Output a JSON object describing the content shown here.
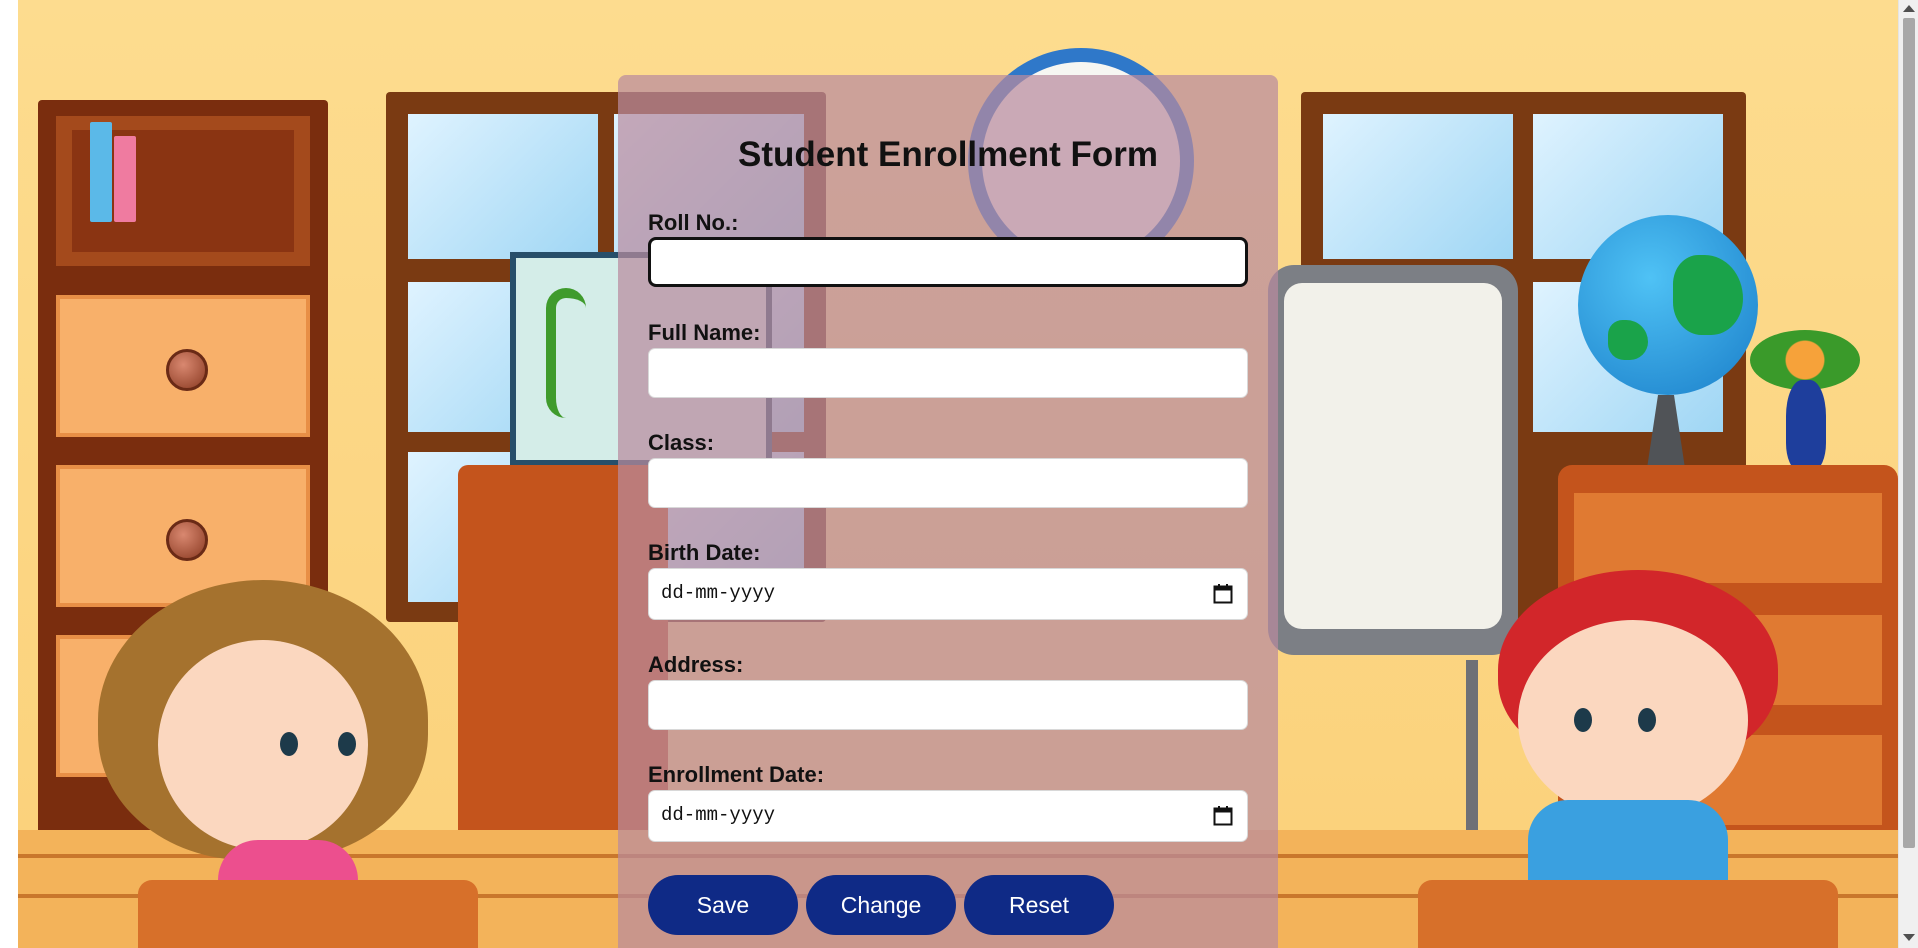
{
  "form": {
    "title": "Student Enrollment Form",
    "fields": [
      {
        "label": "Roll No.:",
        "value": ""
      },
      {
        "label": "Full Name:",
        "value": ""
      },
      {
        "label": "Class:",
        "value": ""
      },
      {
        "label": "Birth Date:",
        "placeholder": "dd-mm-yyyy"
      },
      {
        "label": "Address:",
        "value": ""
      },
      {
        "label": "Enrollment Date:",
        "placeholder": "dd-mm-yyyy"
      }
    ],
    "buttons": {
      "save": "Save",
      "change": "Change",
      "reset": "Reset"
    }
  },
  "colors": {
    "panel_overlay": "#b88a9e",
    "button_bg": "#0f2a86",
    "button_text": "#ffffff",
    "wall": "#fddc8f"
  },
  "icons": {
    "date_picker": "calendar-icon",
    "scroll_up": "scroll-up-arrow-icon",
    "scroll_down": "scroll-down-arrow-icon"
  }
}
